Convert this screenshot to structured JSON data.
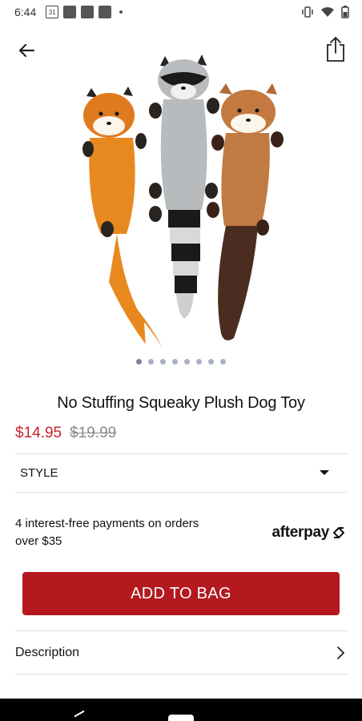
{
  "status_bar": {
    "time": "6:44",
    "calendar_day": "31"
  },
  "product": {
    "title": "No Stuffing Squeaky Plush Dog Toy",
    "price_sale": "$14.95",
    "price_original": "$19.99",
    "image_count": 8,
    "active_image_index": 0
  },
  "options": {
    "style_label": "STYLE"
  },
  "afterpay": {
    "text": "4 interest-free payments on orders over $35",
    "logo_text": "afterpay"
  },
  "actions": {
    "add_to_bag_label": "ADD TO BAG"
  },
  "sections": {
    "description_label": "Description"
  },
  "colors": {
    "brand_red": "#b3191f",
    "sale_red": "#c8232c"
  }
}
